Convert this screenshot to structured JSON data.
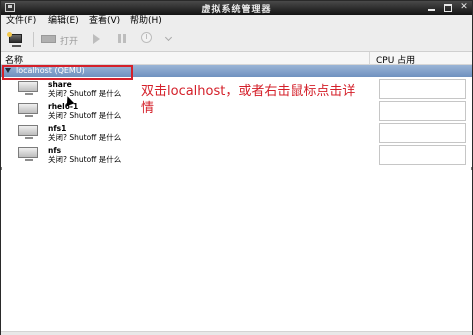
{
  "window": {
    "title": "虚拟系统管理器"
  },
  "menubar": {
    "items": [
      "文件(F)",
      "编辑(E)",
      "查看(V)",
      "帮助(H)"
    ]
  },
  "toolbar": {
    "open_label": "打开"
  },
  "columns": {
    "name": "名称",
    "cpu": "CPU 占用"
  },
  "host": {
    "label": "localhost (QEMU)"
  },
  "vms": [
    {
      "name": "share",
      "status": "关闭? Shutoff 是什么"
    },
    {
      "name": "rhel6-1",
      "status": "关闭? Shutoff 是什么"
    },
    {
      "name": "nfs1",
      "status": "关闭? Shutoff 是什么"
    },
    {
      "name": "nfs",
      "status": "关闭? Shutoff 是什么"
    }
  ],
  "annotation": {
    "text": "双击localhost，或者右击鼠标点击详情"
  },
  "colors": {
    "highlight_border": "#d4202a",
    "annotation_text": "#d4202a",
    "selected_row": "#7f9ccb"
  }
}
